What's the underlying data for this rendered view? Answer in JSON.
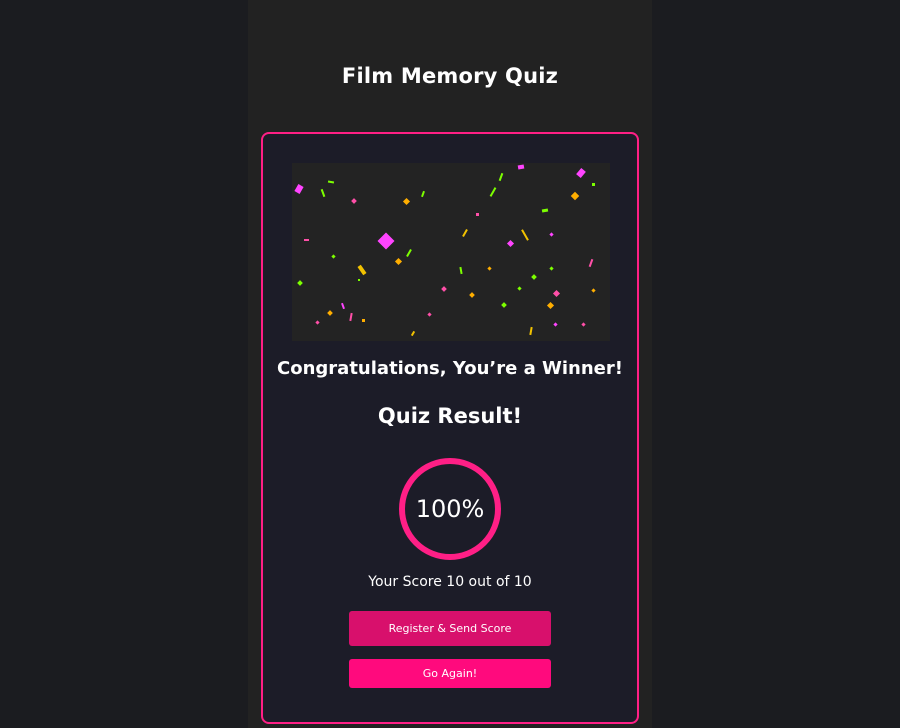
{
  "app": {
    "title": "Film Memory Quiz"
  },
  "result": {
    "congrats": "Congratulations, You’re a Winner!",
    "heading": "Quiz Result!",
    "percent_label": "100%",
    "percent": 100,
    "score_text": "Your Score 10 out of 10"
  },
  "actions": {
    "register_label": "Register & Send Score",
    "again_label": "Go Again!"
  },
  "colors": {
    "accent": "#ff1f86",
    "register_button": "#d8106c",
    "again_button": "#ff0a7d",
    "page_background": "#1b1c20",
    "card_background": "#1c1c28"
  },
  "confetti": {
    "colors": [
      "#ff44ff",
      "#ffae00",
      "#7dff00",
      "#ff4fa8",
      "#f2c200"
    ]
  }
}
